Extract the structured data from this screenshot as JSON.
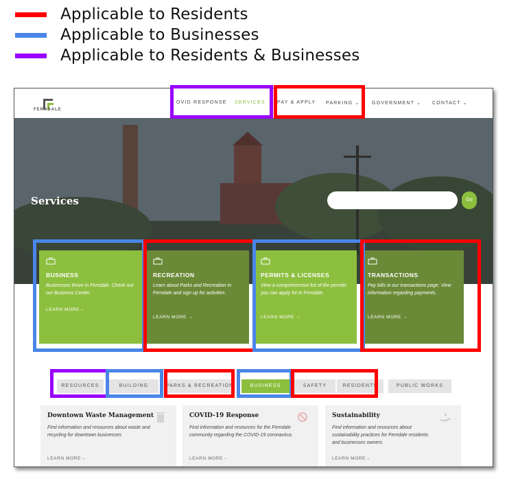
{
  "legend": [
    {
      "label": "Applicable to Residents",
      "color": "#ff0000"
    },
    {
      "label": "Applicable to Businesses",
      "color": "#4a86e8"
    },
    {
      "label": "Applicable to Residents & Businesses",
      "color": "#9900ff"
    }
  ],
  "site": {
    "logo_text": "FERNDALE",
    "nav": [
      {
        "label": "OVID RESPONSE"
      },
      {
        "label": "SERVICES",
        "active": true
      },
      {
        "label": "PAY & APPLY"
      },
      {
        "label": "PARKING ⌄"
      },
      {
        "label": "GOVERNMENT ⌄"
      },
      {
        "label": "CONTACT ⌄"
      }
    ],
    "hero_title": "Services",
    "search_button": "Go",
    "cards": [
      {
        "title": "BUSINESS",
        "desc": "Businesses thrive in Ferndale. Check out our Business Center.",
        "more": "LEARN MORE→",
        "color": "#8dbf3f"
      },
      {
        "title": "RECREATION",
        "desc": "Learn about Parks and Recreation in Ferndale and sign up for activities.",
        "more": "LEARN MORE →",
        "color": "#6b8a37"
      },
      {
        "title": "PERMITS & LICENSES",
        "desc": "View a comprehensive list of the permits you can apply for in Ferndale.",
        "more": "LEARN MORE →",
        "color": "#8dbf3f"
      },
      {
        "title": "TRANSACTIONS",
        "desc": "Pay bills in our transactions page. View information regarding payments.",
        "more": "LEARN MORE →",
        "color": "#6b8a37"
      }
    ],
    "tabs": [
      {
        "label": "RESOURCES"
      },
      {
        "label": "BUILDING"
      },
      {
        "label": "PARKS & RECREATION"
      },
      {
        "label": "BUSINESS",
        "active": true
      },
      {
        "label": "SAFETY"
      },
      {
        "label": "RESIDENTS"
      },
      {
        "label": "PUBLIC WORKS"
      }
    ],
    "panels": [
      {
        "title": "Downtown Waste Management",
        "desc": "Find information and resources about waste and recycling for downtown businesses",
        "more": "LEARN MORE→",
        "icon": "trash-icon"
      },
      {
        "title": "COVID-19 Response",
        "desc": "Find information and resources for the Ferndale community regarding the COVID-19 coronavirus",
        "more": "LEARN MORE→",
        "icon": "virus-icon"
      },
      {
        "title": "Sustainability",
        "desc": "Find information and resources about sustainability practices for Ferndale residents and businesses owners",
        "more": "LEARN MORE→",
        "icon": "recycle-hand-icon"
      }
    ]
  }
}
